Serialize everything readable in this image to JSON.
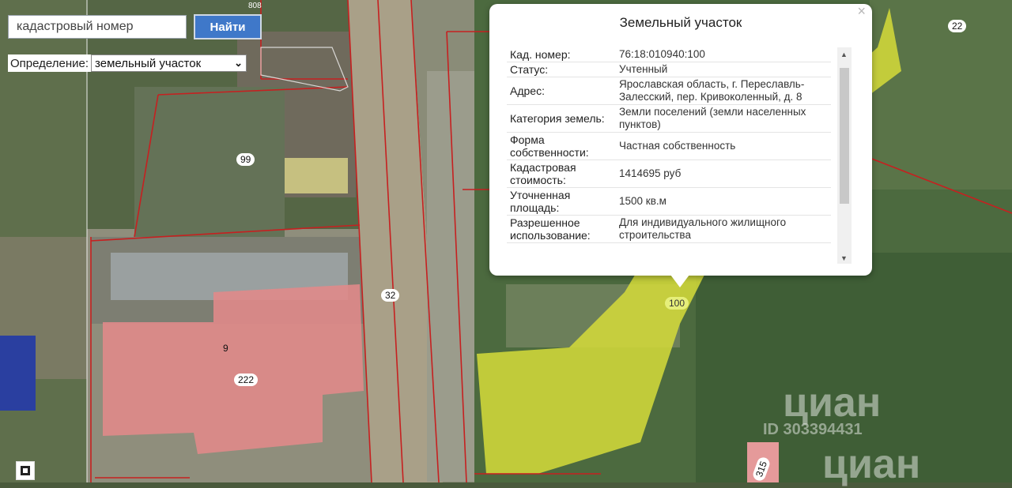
{
  "search": {
    "placeholder": "кадастровый номер",
    "button_label": "Найти"
  },
  "definition": {
    "label": "Определение:",
    "selected": "земельный участок"
  },
  "popup": {
    "title": "Земельный участок",
    "close_glyph": "×",
    "rows": [
      {
        "key": "Кад. номер:",
        "value": "76:18:010940:100"
      },
      {
        "key": "Статус:",
        "value": "Учтенный"
      },
      {
        "key": "Адрес:",
        "value": "Ярославская область, г. Переславль-Залесский, пер. Кривоколенный, д. 8"
      },
      {
        "key": "Категория земель:",
        "value": "Земли поселений (земли населенных пунктов)"
      },
      {
        "key": "Форма собственности:",
        "value": "Частная собственность"
      },
      {
        "key": "Кадастровая стоимость:",
        "value": "1414695 руб"
      },
      {
        "key": "Уточненная площадь:",
        "value": "1500 кв.м"
      },
      {
        "key": "Разрешенное использование:",
        "value": "Для индивидуального жилищного строительства"
      }
    ]
  },
  "map": {
    "plot_numbers": [
      "99",
      "32",
      "9",
      "222",
      "100",
      "22",
      "315",
      "808"
    ],
    "watermark_brand": "циан",
    "watermark_id": "ID 303394431",
    "colors": {
      "selected_plot": "#d6dc3a",
      "pink_plot": "#e08a8a",
      "boundary": "#c62020"
    }
  },
  "icons": {
    "select_chevron": "chevron-down-icon",
    "scroll_up": "scroll-up-icon",
    "scroll_down": "scroll-down-icon",
    "corner": "map-layer-icon"
  }
}
